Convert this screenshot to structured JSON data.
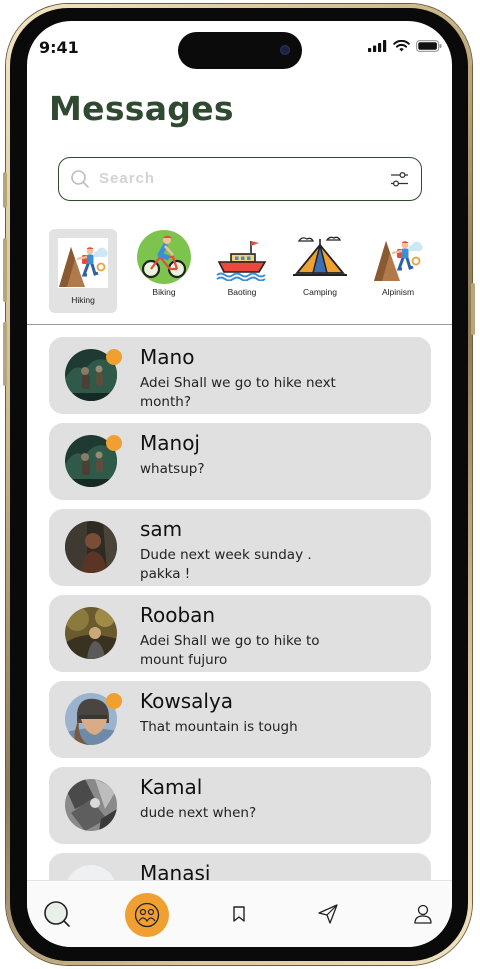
{
  "status_bar": {
    "time": "9:41"
  },
  "header": {
    "title": "Messages"
  },
  "search": {
    "placeholder": "Search",
    "value": ""
  },
  "categories": [
    {
      "label": "Hiking",
      "icon": "hiking-icon",
      "active": true
    },
    {
      "label": "Biking",
      "icon": "biking-icon",
      "active": false
    },
    {
      "label": "Baoting",
      "icon": "boat-icon",
      "active": false
    },
    {
      "label": "Camping",
      "icon": "camping-tent-icon",
      "active": false
    },
    {
      "label": "Alpinism",
      "icon": "climbing-icon",
      "active": false
    }
  ],
  "messages": [
    {
      "name": "Mano",
      "text": "Adei Shall we go to hike next month?",
      "online": true
    },
    {
      "name": "Manoj",
      "text": "whatsup?",
      "online": true
    },
    {
      "name": "sam",
      "text": "Dude next week sunday . pakka !",
      "online": false
    },
    {
      "name": "Rooban",
      "text": "Adei Shall we go to hike  to mount fujuro",
      "online": false
    },
    {
      "name": "Kowsalya",
      "text": "That mountain is tough",
      "online": true
    },
    {
      "name": "Kamal",
      "text": "dude next when?",
      "online": false
    },
    {
      "name": "Manasi",
      "text": "",
      "online": false
    }
  ],
  "bottom_nav": {
    "items": [
      "search-icon",
      "community-icon",
      "bookmark-icon",
      "send-icon",
      "profile-icon"
    ],
    "active": "community-icon"
  },
  "colors": {
    "accent": "#f0a030",
    "title": "#2f4a30",
    "card": "#e0e0e0"
  }
}
